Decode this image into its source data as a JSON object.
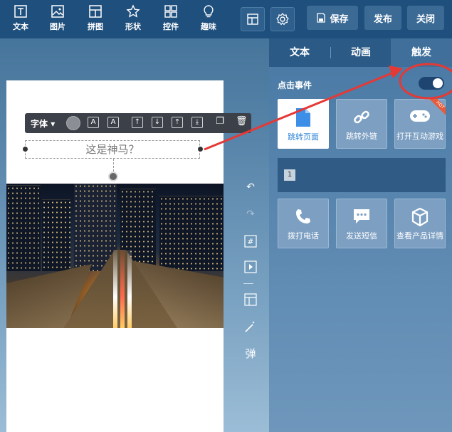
{
  "toolbar": {
    "tools": [
      {
        "label": "文本",
        "icon": "text-icon"
      },
      {
        "label": "图片",
        "icon": "image-icon"
      },
      {
        "label": "拼图",
        "icon": "collage-icon"
      },
      {
        "label": "形状",
        "icon": "star-icon"
      },
      {
        "label": "控件",
        "icon": "widgets-icon"
      },
      {
        "label": "趣味",
        "icon": "bulb-icon"
      }
    ],
    "save_label": "保存",
    "publish_label": "发布",
    "close_label": "关闭"
  },
  "editor": {
    "font_label": "字体",
    "textbox_text": "这是神马？",
    "side_text_tool": "弹"
  },
  "panel": {
    "tabs": [
      "文本",
      "动画",
      "触发"
    ],
    "active_tab": "触发",
    "event_label": "点击事件",
    "event_enabled": true,
    "actions_row1": [
      {
        "label": "跳转页面",
        "icon": "page-icon",
        "selected": true
      },
      {
        "label": "跳转外链",
        "icon": "link-icon",
        "selected": false
      },
      {
        "label": "打开互动游戏",
        "icon": "gamepad-icon",
        "selected": false,
        "badge": "HOT"
      }
    ],
    "page_number": "1",
    "actions_row2": [
      {
        "label": "拨打电话",
        "icon": "phone-icon"
      },
      {
        "label": "发送短信",
        "icon": "sms-icon"
      },
      {
        "label": "查看产品详情",
        "icon": "box-icon"
      }
    ]
  },
  "colors": {
    "accent_red": "#e53935",
    "selected_blue": "#2f84d8"
  }
}
